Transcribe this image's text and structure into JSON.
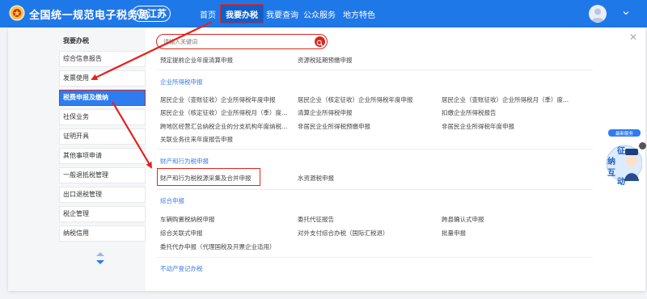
{
  "header": {
    "site_title": "全国统一规范电子税务局",
    "region": "江苏",
    "nav": [
      "首页",
      "我要办税",
      "我要查询",
      "公众服务",
      "地方特色"
    ]
  },
  "sidebar": {
    "title": "我要办税",
    "items": [
      "综合信息报告",
      "发票使用",
      "税费申报及缴纳",
      "社保业务",
      "证明开具",
      "其他事项申请",
      "一般退抵税管理",
      "出口退税管理",
      "税企管理",
      "纳税信用"
    ]
  },
  "search": {
    "placeholder": "请输入关键词"
  },
  "content": {
    "top_links": [
      "预定提前企业年度清算申报",
      "资源税延期预缴申报"
    ],
    "sections": [
      {
        "title": "企业所得税申报",
        "links": [
          "居民企业（查账征收）企业所得税年度申报",
          "居民企业（核定征收）企业所得税年度申报",
          "居民企业（查账征收）企业所得税月（季）度...",
          "居民企业（核定征收）企业所得税月（季）度...",
          "清算企业所得税申报",
          "扣缴企业所得税报告",
          "跨地区经营汇总纳税企业的分支机构年度纳税...",
          "非居民企业所得税预缴申报",
          "非居民企业所得税年度申报",
          "关联业务往来年度报告申报"
        ]
      },
      {
        "title": "财产和行为税申报",
        "links": [
          "财产和行为税税源采集及合并申报",
          "水资源税申报"
        ]
      },
      {
        "title": "综合申报",
        "links": [
          "车辆购置税纳税申报",
          "委托代征报告",
          "跨县确认式申报",
          "综合关联式申报",
          "对外支付综合办税（国际汇税退）",
          "批量申报",
          "委托代办申报（代理国税及开票企业适用）"
        ]
      },
      {
        "title": "不动产登记办税"
      }
    ]
  },
  "widget": {
    "label_top": "最新服务",
    "chars": [
      "征",
      "纳",
      "互",
      "动"
    ]
  },
  "colors": {
    "brand": "#1f78e8",
    "highlight": "#e3231a",
    "section_title": "#3a7be0"
  }
}
